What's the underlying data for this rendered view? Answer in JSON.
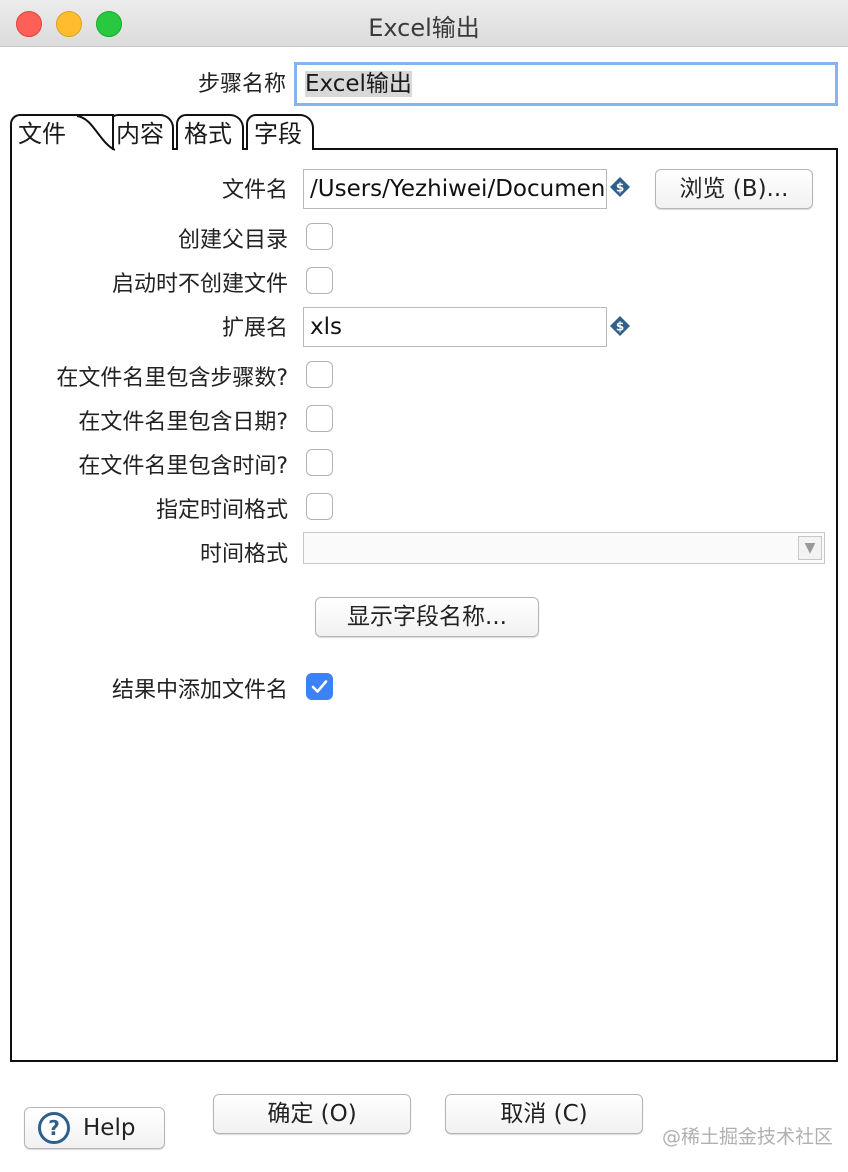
{
  "window": {
    "title": "Excel输出"
  },
  "step_name": {
    "label": "步骤名称",
    "value": "Excel输出"
  },
  "tabs": [
    {
      "label": "文件",
      "active": true
    },
    {
      "label": "内容",
      "active": false
    },
    {
      "label": "格式",
      "active": false
    },
    {
      "label": "字段",
      "active": false
    }
  ],
  "file_tab": {
    "filename_label": "文件名",
    "filename_value": "/Users/Yezhiwei/Documen",
    "browse_button": "浏览 (B)...",
    "create_parent_folder_label": "创建父目录",
    "no_create_at_start_label": "启动时不创建文件",
    "extension_label": "扩展名",
    "extension_value": "xls",
    "include_stepnr_label": "在文件名里包含步骤数?",
    "include_date_label": "在文件名里包含日期?",
    "include_time_label": "在文件名里包含时间?",
    "specify_format_label": "指定时间格式",
    "time_format_label": "时间格式",
    "time_format_value": "",
    "show_fields_button": "显示字段名称...",
    "add_to_result_label": "结果中添加文件名",
    "checkboxes": {
      "create_parent_folder": false,
      "no_create_at_start": false,
      "include_stepnr": false,
      "include_date": false,
      "include_time": false,
      "specify_format": false,
      "add_to_result": true
    }
  },
  "footer": {
    "help_button": "Help",
    "ok_button": "确定 (O)",
    "cancel_button": "取消 (C)"
  },
  "watermark": "@稀土掘金技术社区",
  "colors": {
    "checkbox_checked": "#3b82f6",
    "focus_ring": "#86b2ee"
  },
  "icons": {
    "variable": "variable-dollar-icon",
    "help": "help-question-icon",
    "dropdown": "chevron-down-icon"
  }
}
